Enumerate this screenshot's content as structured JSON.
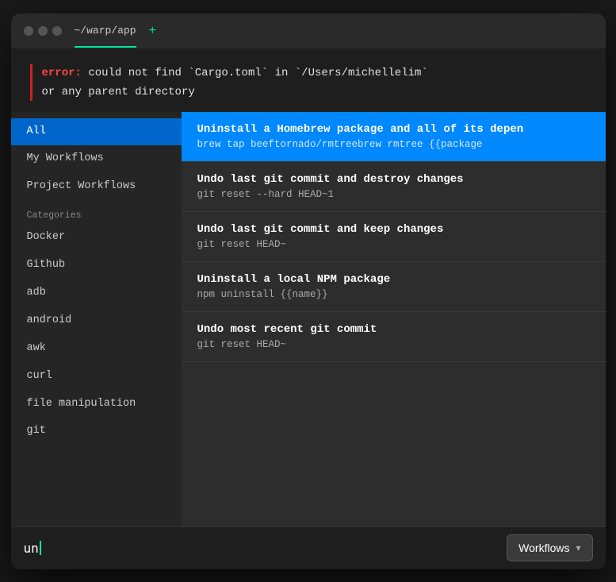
{
  "titlebar": {
    "path": "~/warp/app",
    "plus_label": "+",
    "dots": [
      "dot1",
      "dot2",
      "dot3"
    ]
  },
  "terminal": {
    "error_keyword": "error:",
    "error_message": " could not find `Cargo.toml` in `/Users/michellelim`",
    "error_or": "or any parent directory"
  },
  "sidebar": {
    "items": [
      {
        "label": "All",
        "active": true
      },
      {
        "label": "My Workflows",
        "active": false
      },
      {
        "label": "Project Workflows",
        "active": false
      }
    ],
    "category_label": "Categories",
    "categories": [
      {
        "label": "Docker"
      },
      {
        "label": "Github"
      },
      {
        "label": "adb"
      },
      {
        "label": "android"
      },
      {
        "label": "awk"
      },
      {
        "label": "curl"
      },
      {
        "label": "file manipulation"
      },
      {
        "label": "git"
      }
    ]
  },
  "results": [
    {
      "title": "Uninstall a Homebrew package and all of its depen",
      "command": "brew tap beeftornado/rmtreebrew rmtree {{package",
      "selected": true
    },
    {
      "title": "Undo last git commit and destroy changes",
      "command": "git reset --hard HEAD~1",
      "selected": false
    },
    {
      "title": "Undo last git commit and keep changes",
      "command": "git reset HEAD~",
      "selected": false
    },
    {
      "title": "Uninstall a local NPM package",
      "command": "npm uninstall {{name}}",
      "selected": false
    },
    {
      "title": "Undo most recent git commit",
      "command": "git reset HEAD~",
      "selected": false
    }
  ],
  "bottom_input": {
    "text": "un",
    "workflows_label": "Workflows"
  }
}
